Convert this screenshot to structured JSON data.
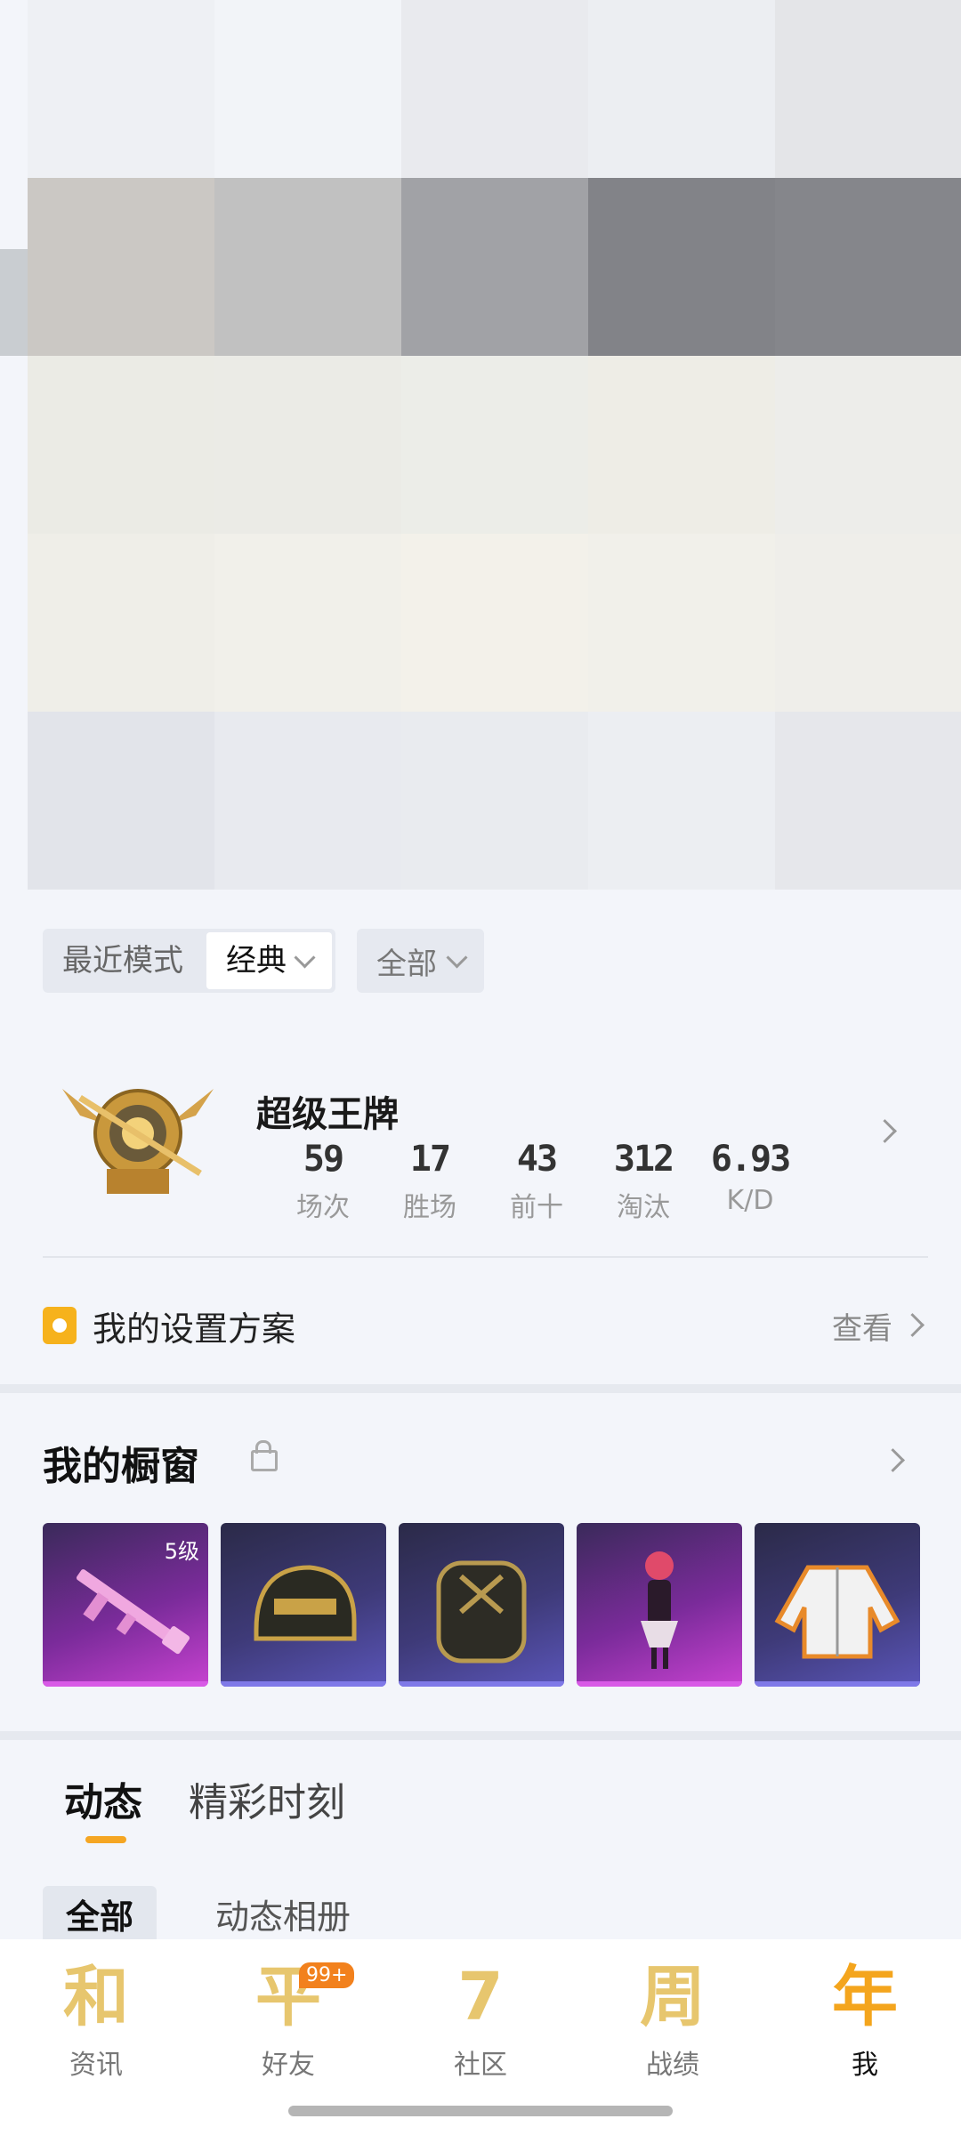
{
  "filters": {
    "mode_label": "最近模式",
    "mode_value": "经典",
    "scope_value": "全部"
  },
  "rank": {
    "title": "超级王牌",
    "stats": [
      {
        "value": "59",
        "label": "场次"
      },
      {
        "value": "17",
        "label": "胜场"
      },
      {
        "value": "43",
        "label": "前十"
      },
      {
        "value": "312",
        "label": "淘汰"
      },
      {
        "value": "6.93",
        "label": "K/D"
      }
    ]
  },
  "settings": {
    "title": "我的设置方案",
    "view_label": "查看"
  },
  "showcase": {
    "title": "我的橱窗",
    "items": [
      {
        "name": "pink-rifle",
        "level": "5级"
      },
      {
        "name": "helmet"
      },
      {
        "name": "backpack"
      },
      {
        "name": "character"
      },
      {
        "name": "jacket"
      }
    ]
  },
  "tabs": [
    "动态",
    "精彩时刻"
  ],
  "subtabs": [
    "全部",
    "动态相册"
  ],
  "nav": [
    {
      "icon": "和",
      "label": "资讯"
    },
    {
      "icon": "平",
      "label": "好友",
      "badge": "99+"
    },
    {
      "icon": "7",
      "label": "社区"
    },
    {
      "icon": "周",
      "label": "战绩"
    },
    {
      "icon": "年",
      "label": "我"
    }
  ],
  "colors": {
    "accent": "#f5a623",
    "nav_icon": "#e7c66e",
    "badge": "#f2811d"
  }
}
